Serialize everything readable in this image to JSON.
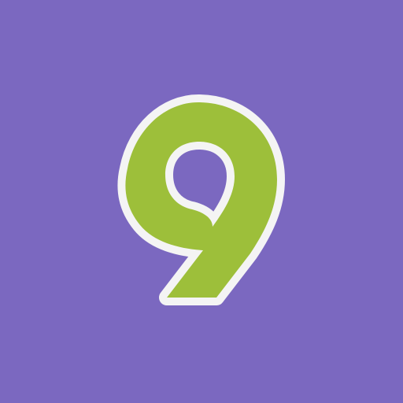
{
  "app_icon": {
    "glyph": "9",
    "icon_name": "nine-logo-icon",
    "colors": {
      "background": "#7b68c0",
      "glyph_fill": "#9dbf3a",
      "glyph_outline": "#f4f4f4"
    }
  }
}
